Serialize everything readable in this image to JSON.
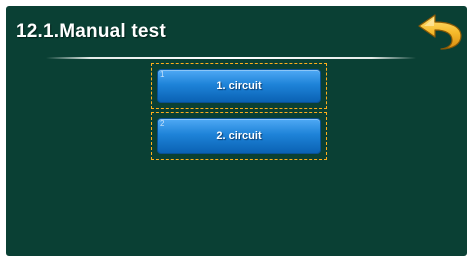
{
  "header": {
    "title": "12.1.Manual test",
    "back_icon": "back-arrow-icon"
  },
  "options": [
    {
      "index": "1",
      "label": "1. circuit"
    },
    {
      "index": "2",
      "label": "2. circuit"
    }
  ],
  "colors": {
    "panel_background": "#0a4034",
    "button_blue": "#1e83d8",
    "focus_frame": "#ffae1a",
    "back_icon": "#f5b82a"
  }
}
